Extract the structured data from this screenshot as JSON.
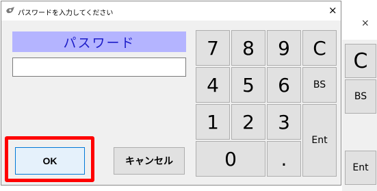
{
  "window": {
    "title": "パスワードを入力してください",
    "close_symbol": "×"
  },
  "password": {
    "label": "パスワード",
    "value": "",
    "placeholder": ""
  },
  "keypad": {
    "k7": "7",
    "k8": "8",
    "k9": "9",
    "clear": "C",
    "k4": "4",
    "k5": "5",
    "k6": "6",
    "backspace": "BS",
    "k1": "1",
    "k2": "2",
    "k3": "3",
    "enter": "Ent",
    "k0": "0",
    "dot": "."
  },
  "buttons": {
    "ok": "OK",
    "cancel": "キャンセル"
  },
  "background_dialog": {
    "close_symbol": "×",
    "clear": "C",
    "backspace": "BS",
    "enter": "Ent"
  },
  "colors": {
    "label_background": "#b4b4ff",
    "label_text": "#1c1cc8",
    "highlight": "#ff0000",
    "ok_border": "#0078d7"
  }
}
